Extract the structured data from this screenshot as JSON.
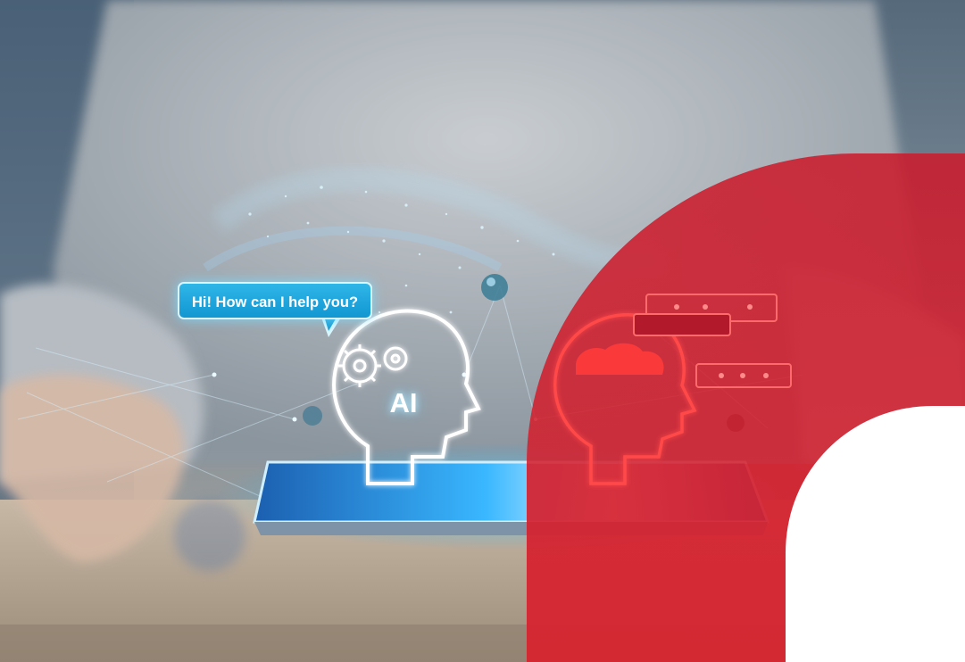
{
  "scene": {
    "chat_bubble": {
      "text": "Hi! How can I help you?"
    },
    "hologram": {
      "label": "AI"
    },
    "colors": {
      "brand_red": "#d7202f",
      "hologram_cyan": "#27b4ea",
      "bubble_blue": "#1b9fd8",
      "background_white": "#ffffff"
    },
    "icons": [
      "ai-head-icon",
      "gear-icon",
      "brain-icon",
      "message-bar-icon"
    ]
  }
}
